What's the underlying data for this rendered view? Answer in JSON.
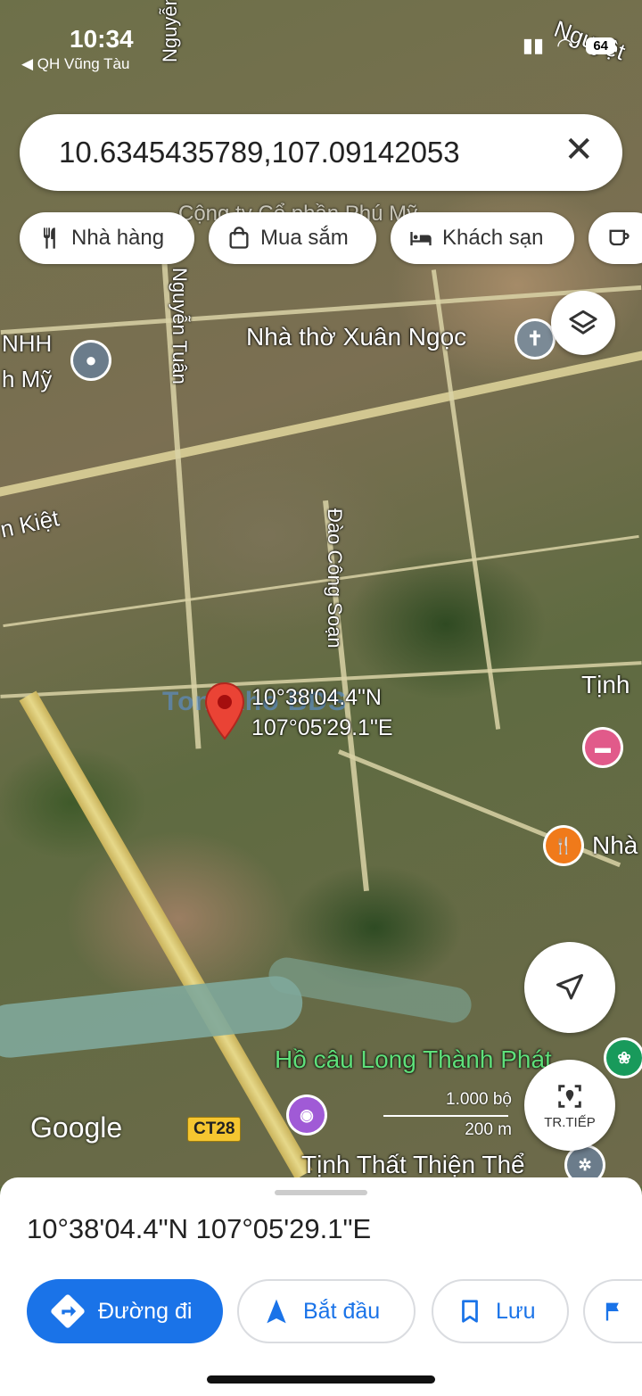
{
  "status_bar": {
    "time": "10:34",
    "back_app": "◀ QH Vũng Tàu",
    "battery": "64"
  },
  "search": {
    "value": "10.6345435789,107.09142053"
  },
  "chips": [
    {
      "label": "Nhà hàng",
      "icon": "fork-knife-icon"
    },
    {
      "label": "Mua sắm",
      "icon": "shopping-bag-icon"
    },
    {
      "label": "Khách sạn",
      "icon": "bed-icon"
    }
  ],
  "map": {
    "labels": {
      "nguyen_tuan_top": "Nguyễn Tu",
      "nguyen_tuan": "Nguyễn Tuân",
      "nguyet_top": "Nguyệt",
      "church": "Nhà thờ Xuân Ngọc",
      "nhh": "NHH",
      "my": "h Mỹ",
      "kiet": "n Kiệt",
      "dao_cong_soan": "Đào Công Soạn",
      "tinh": "Tịnh",
      "nha": "Nhà",
      "ho_cau": "Hồ câu Long Thành Phát",
      "tinh_that": "Tịnh Thất Thiện Thể",
      "cong": "Cộng ty Cổ phần Phú Mỹ"
    },
    "pin_label_line1": "10°38'04.4\"N",
    "pin_label_line2": "107°05'29.1\"E",
    "watermark": "Tongkho BDS",
    "google": "Google",
    "road_badge": "CT28",
    "scale_top": "1.000 bộ",
    "scale_bottom": "200 m",
    "tr_tiep_label": "TR.TIẾP"
  },
  "sheet": {
    "coordinates": "10°38'04.4\"N 107°05'29.1\"E",
    "actions": [
      {
        "label": "Đường đi",
        "icon": "directions-icon"
      },
      {
        "label": "Bắt đầu",
        "icon": "navigation-arrow-icon"
      },
      {
        "label": "Lưu",
        "icon": "bookmark-icon"
      }
    ]
  },
  "colors": {
    "accent": "#1a73e8",
    "pin": "#ea4335"
  }
}
